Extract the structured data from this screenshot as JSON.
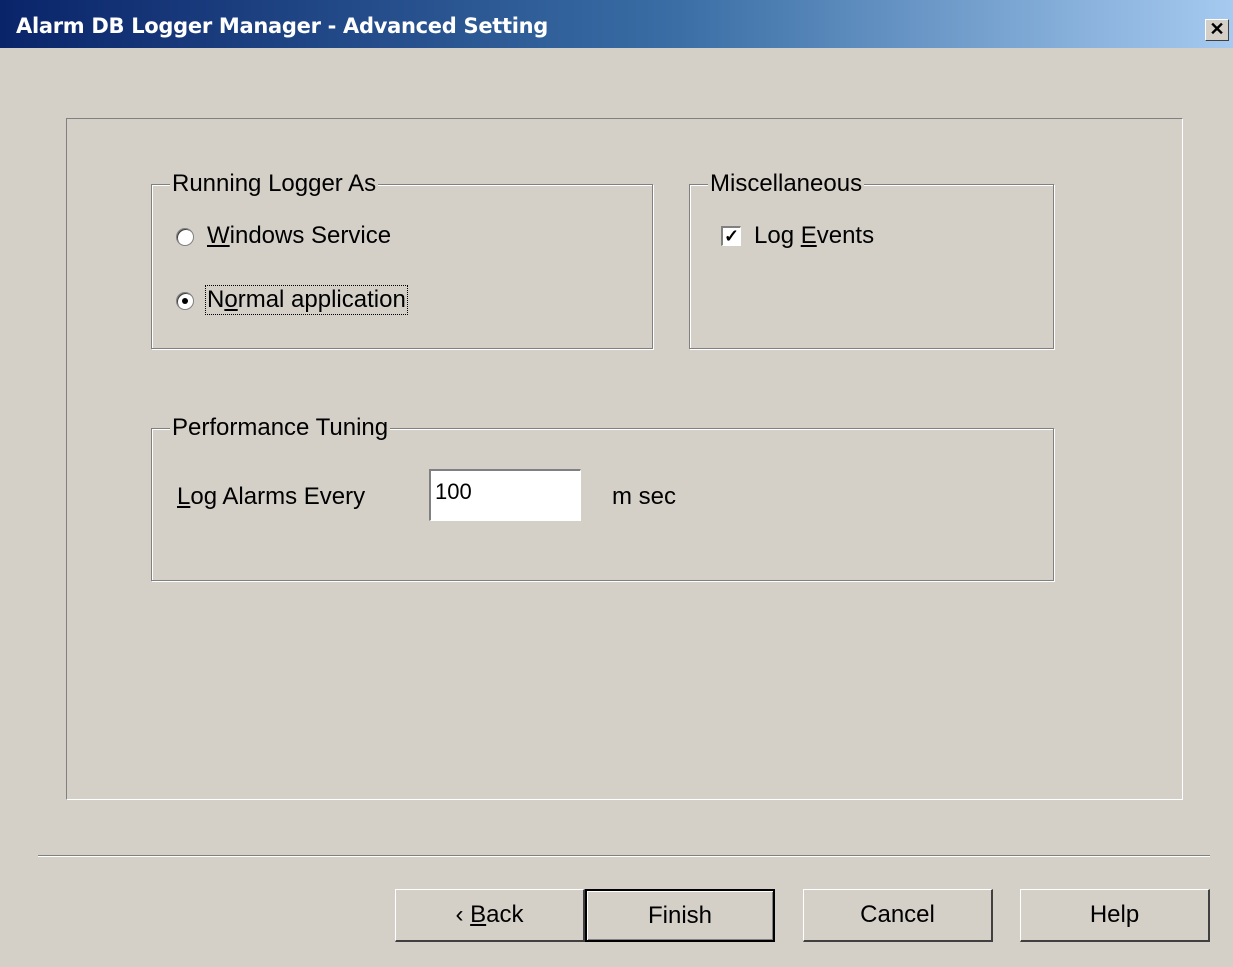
{
  "window": {
    "title": "Alarm DB Logger Manager - Advanced Setting",
    "close_glyph": "✕"
  },
  "running_logger": {
    "legend": "Running Logger As",
    "options": [
      {
        "prefix": "",
        "mnemonic": "W",
        "rest": "indows Service",
        "selected": false
      },
      {
        "prefix": "N",
        "mnemonic": "o",
        "rest": "rmal application",
        "selected": true
      }
    ]
  },
  "misc": {
    "legend": "Miscellaneous",
    "log_events": {
      "prefix": "Log ",
      "mnemonic": "E",
      "rest": "vents",
      "checked": true,
      "check_glyph": "✓"
    }
  },
  "performance": {
    "legend": "Performance Tuning",
    "label_mnemonic": "L",
    "label_rest": "og Alarms Every",
    "value": "100",
    "unit": "m sec"
  },
  "buttons": {
    "back": {
      "arrow": "‹",
      "mnemonic": "B",
      "rest": "ack"
    },
    "finish": "Finish",
    "cancel": "Cancel",
    "help": "Help"
  }
}
